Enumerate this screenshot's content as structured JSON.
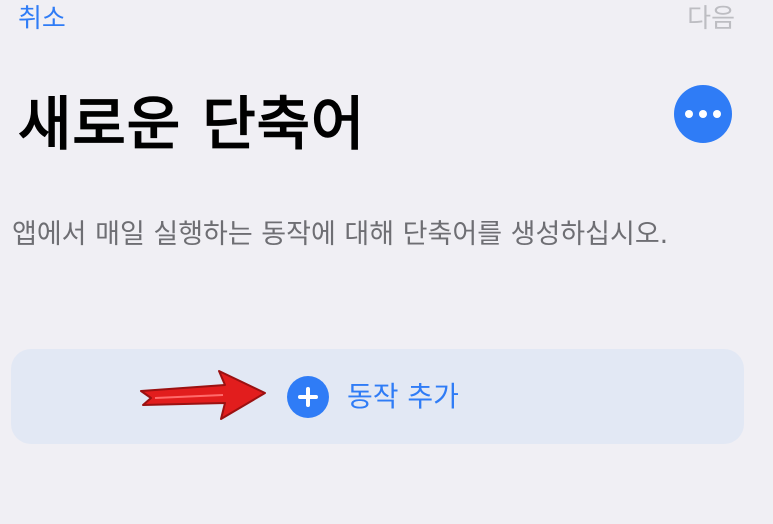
{
  "nav": {
    "cancel_label": "취소",
    "next_label": "다음"
  },
  "header": {
    "title": "새로운 단축어",
    "more_icon": "ellipsis-circle-icon"
  },
  "description": "앱에서 매일 실행하는 동작에 대해 단축어를 생성하십시오.",
  "add_action": {
    "label": "동작 추가",
    "icon": "plus-circle-icon"
  },
  "annotation": {
    "icon": "red-arrow-icon"
  },
  "colors": {
    "background": "#f0eff4",
    "accent": "#2f7cf6",
    "disabled": "#bdbdc2",
    "card": "#e2e8f4",
    "secondary_text": "#6e6e73",
    "annotation_arrow": "#e21d1d"
  }
}
